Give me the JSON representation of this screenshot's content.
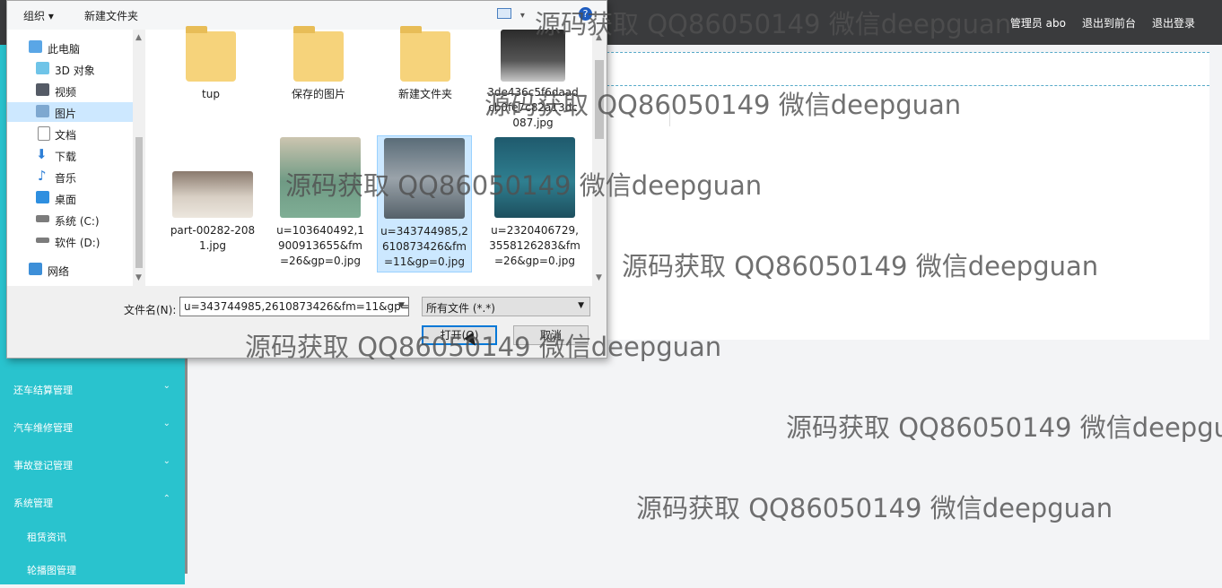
{
  "topbar": {
    "links": [
      "管理员 abo",
      "退出到前台",
      "退出登录"
    ]
  },
  "sidebar": {
    "items": [
      {
        "label": "还车结算管理",
        "chevron": "chevron-down"
      },
      {
        "label": "汽车维修管理",
        "chevron": "chevron-down"
      },
      {
        "label": "事故登记管理",
        "chevron": "chevron-down"
      },
      {
        "label": "系统管理",
        "chevron": "chevron-up"
      },
      {
        "label": "租赁资讯"
      },
      {
        "label": "轮播图管理"
      }
    ]
  },
  "dialog": {
    "toolbar": {
      "organize_label": "组织 ▾",
      "new_folder_label": "新建文件夹",
      "view_label": "▾",
      "help_label": "?"
    },
    "nav": [
      {
        "label": "此电脑",
        "icon": "computer-icon"
      },
      {
        "label": "3D 对象",
        "icon": "cube-icon"
      },
      {
        "label": "视频",
        "icon": "video-icon"
      },
      {
        "label": "图片",
        "icon": "pictures-icon",
        "selected": true
      },
      {
        "label": "文档",
        "icon": "document-icon"
      },
      {
        "label": "下载",
        "icon": "download-icon"
      },
      {
        "label": "音乐",
        "icon": "music-icon"
      },
      {
        "label": "桌面",
        "icon": "desktop-icon"
      },
      {
        "label": "系统 (C:)",
        "icon": "drive-icon"
      },
      {
        "label": "软件 (D:)",
        "icon": "drive-icon"
      },
      {
        "label": "网络",
        "icon": "network-icon"
      }
    ],
    "files": [
      {
        "name": "tup",
        "kind": "folder"
      },
      {
        "name": "保存的图片",
        "kind": "folder"
      },
      {
        "name": "新建文件夹",
        "kind": "folder"
      },
      {
        "name": "3de436c5f6daadcb0fe7c82a13dc087.jpg",
        "kind": "image"
      },
      {
        "name": "part-00282-2081.jpg",
        "kind": "image"
      },
      {
        "name": "u=103640492,1900913655&fm=26&gp=0.jpg",
        "kind": "image"
      },
      {
        "name": "u=343744985,2610873426&fm=11&gp=0.jpg",
        "kind": "image",
        "selected": true
      },
      {
        "name": "u=2320406729,3558126283&fm=26&gp=0.jpg",
        "kind": "image"
      }
    ],
    "filename_label": "文件名(N):",
    "filename_value": "u=343744985,2610873426&fm=11&gp=",
    "filetype_value": "所有文件 (*.*)",
    "open_label": "打开(O)",
    "cancel_label": "取消"
  },
  "watermarks": [
    "源码获取 QQ86050149 微信deepguan",
    "源码获取 QQ86050149 微信deepguan",
    "源码获取 QQ86050149 微信deepguan",
    "源码获取 QQ86050149 微信deepguan",
    "源码获取 QQ86050149 微信deepguan",
    "源码获取 QQ86050149 微信deepgu",
    "源码获取 QQ86050149 微信deepguan"
  ]
}
